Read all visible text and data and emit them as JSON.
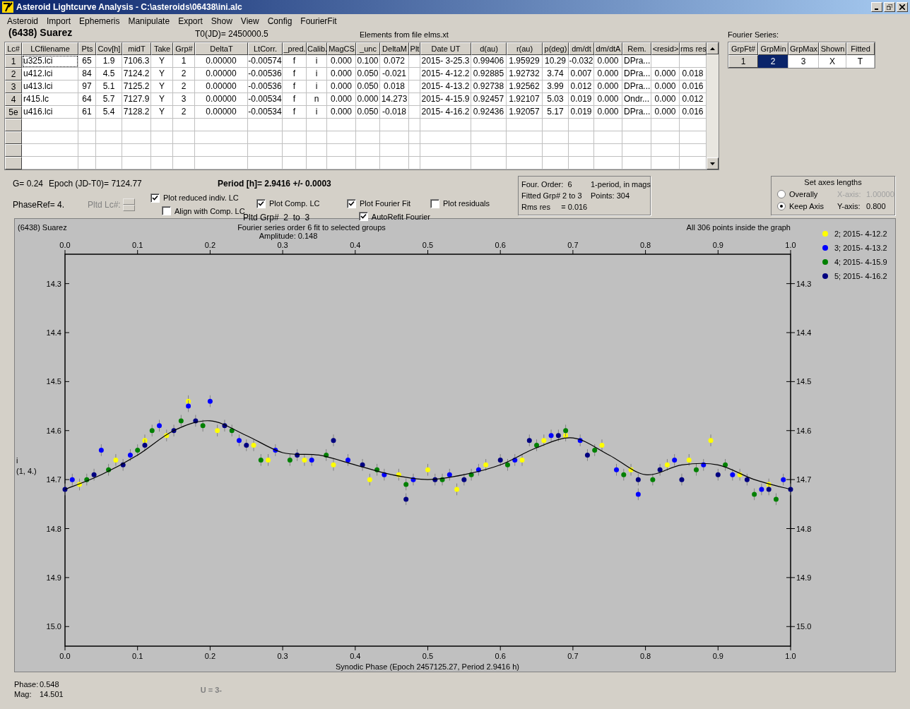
{
  "window": {
    "title": "Asteroid Lightcurve Analysis - C:\\asteroids\\06438\\ini.alc"
  },
  "menu": [
    "Asteroid",
    "Import",
    "Ephemeris",
    "Manipulate",
    "Export",
    "Show",
    "View",
    "Config",
    "FourierFit"
  ],
  "header": {
    "object": "(6438) Suarez",
    "t0": "T0(JD)= 2450000.5",
    "elements": "Elements from file elms.xt"
  },
  "table": {
    "columns": [
      "Lc#",
      "LCfilename",
      "Pts",
      "Cov[h]",
      "midT",
      "Take",
      "Grp#",
      "DeltaT",
      "LtCorr.",
      "_pred.",
      "Calib.",
      "MagCS",
      "_unc",
      "DeltaM",
      "Plt",
      "Date UT",
      "d(au)",
      "r(au)",
      "p(deg)",
      "dm/dt",
      "dm/dtA",
      "Rem.",
      "<resid>",
      "rms res"
    ],
    "rows": [
      {
        "focused": true,
        "cells": [
          "1",
          "u325.lci",
          "65",
          "1.9",
          "7106.3",
          "Y",
          "1",
          "0.00000",
          "-0.00574",
          "f",
          "i",
          "0.000",
          "0.100",
          "0.072",
          null,
          "2015- 3-25.3",
          "0.99406",
          "1.95929",
          "10.29",
          "-0.032",
          "0.000",
          "DPra...",
          null,
          null
        ]
      },
      {
        "focused": false,
        "cells": [
          "2",
          "u412.lci",
          "84",
          "4.5",
          "7124.2",
          "Y",
          "2",
          "0.00000",
          "-0.00536",
          "f",
          "i",
          "0.000",
          "0.050",
          "-0.021",
          null,
          "2015- 4-12.2",
          "0.92885",
          "1.92732",
          "3.74",
          "0.007",
          "0.000",
          "DPra...",
          "0.000",
          "0.018"
        ]
      },
      {
        "focused": false,
        "cells": [
          "3",
          "u413.lci",
          "97",
          "5.1",
          "7125.2",
          "Y",
          "2",
          "0.00000",
          "-0.00536",
          "f",
          "i",
          "0.000",
          "0.050",
          "0.018",
          null,
          "2015- 4-13.2",
          "0.92738",
          "1.92562",
          "3.99",
          "0.012",
          "0.000",
          "DPra...",
          "0.000",
          "0.016"
        ]
      },
      {
        "focused": false,
        "cells": [
          "4",
          "r415.lc",
          "64",
          "5.7",
          "7127.9",
          "Y",
          "3",
          "0.00000",
          "-0.00534",
          "f",
          "n",
          "0.000",
          "0.000",
          "14.273",
          null,
          "2015- 4-15.9",
          "0.92457",
          "1.92107",
          "5.03",
          "0.019",
          "0.000",
          "Ondr...",
          "0.000",
          "0.012"
        ]
      },
      {
        "focused": false,
        "cells": [
          "5e",
          "u416.lci",
          "61",
          "5.4",
          "7128.2",
          "Y",
          "2",
          "0.00000",
          "-0.00534",
          "f",
          "i",
          "0.000",
          "0.050",
          "-0.018",
          null,
          "2015- 4-16.2",
          "0.92436",
          "1.92057",
          "5.17",
          "0.019",
          "0.000",
          "DPra...",
          "0.000",
          "0.016"
        ]
      }
    ]
  },
  "fourier_series": {
    "label": "Fourier Series:",
    "columns": [
      "GrpFt#",
      "GrpMin",
      "GrpMax",
      "Shown",
      "Fitted"
    ],
    "row": {
      "header": "1",
      "cells": [
        {
          "text": "2",
          "selected": true
        },
        {
          "text": "3",
          "selected": false
        },
        {
          "text": "X",
          "selected": false
        },
        {
          "text": "T",
          "selected": false
        }
      ]
    }
  },
  "params": {
    "g": "G= 0.24",
    "epoch": "Epoch (JD-T0)= 7124.77",
    "phaseref": "PhaseRef= 4.",
    "period": "Period [h]= 2.9416 +/- 0.0003",
    "pltd_lc": {
      "label": "Pltd Lc#:",
      "disabled": true
    },
    "pltd_grp": "Pltd Grp#  2  to  3"
  },
  "options": [
    {
      "label": "Plot reduced indiv. LC",
      "checked": true
    },
    {
      "label": "Align with Comp. LC",
      "checked": false
    },
    {
      "label": "Plot Comp. LC",
      "checked": true
    },
    {
      "label": "Plot Fourier Fit",
      "checked": true
    },
    {
      "label": "Plot residuals",
      "checked": false
    },
    {
      "label": "AutoRefit Fourier",
      "checked": true
    }
  ],
  "fit_info": [
    "Four. Order:  6",
    "1-period, in mags",
    "Fitted Grp# 2 to 3",
    "Points: 304",
    "Rms res     = 0.016"
  ],
  "axes_lengths": {
    "title": "Set axes lengths",
    "modes": [
      {
        "label": "Overally",
        "selected": false
      },
      {
        "label": "Keep Axis",
        "selected": true
      }
    ],
    "fields": [
      {
        "label": "X-axis:",
        "value": "1.00000",
        "disabled": true
      },
      {
        "label": "Y-axis:",
        "value": "0.800",
        "disabled": false
      }
    ]
  },
  "plot": {
    "object": "(6438) Suarez",
    "amplitude": "Amplitude: 0.148",
    "points_note": "All 306 points inside the graph",
    "ylabel_extra": "(1, 4.)",
    "chart_data": {
      "type": "scatter",
      "title": "Fourier series order 6 fit to selected groups",
      "legend": "right",
      "xlabel": "Synodic Phase (Epoch 2457125.27, Period 2.9416 h)",
      "ylabel": "i",
      "xlim": [
        0,
        1
      ],
      "ylim": [
        15.04,
        14.24
      ],
      "xticks": [
        {
          "value": 0,
          "label": "0.0"
        },
        {
          "value": 0.1,
          "label": "0.1"
        },
        {
          "value": 0.2,
          "label": "0.2"
        },
        {
          "value": 0.3,
          "label": "0.3"
        },
        {
          "value": 0.4,
          "label": "0.4"
        },
        {
          "value": 0.5,
          "label": "0.5"
        },
        {
          "value": 0.6,
          "label": "0.6"
        },
        {
          "value": 0.7,
          "label": "0.7"
        },
        {
          "value": 0.8,
          "label": "0.8"
        },
        {
          "value": 0.9,
          "label": "0.9"
        },
        {
          "value": 1,
          "label": "1.0"
        }
      ],
      "yticks": [
        {
          "value": 14.3,
          "label": "14.3"
        },
        {
          "value": 14.4,
          "label": "14.4"
        },
        {
          "value": 14.5,
          "label": "14.5"
        },
        {
          "value": 14.6,
          "label": "14.6"
        },
        {
          "value": 14.7,
          "label": "14.7"
        },
        {
          "value": 14.8,
          "label": "14.8"
        },
        {
          "value": 14.9,
          "label": "14.9"
        },
        {
          "value": 15,
          "label": "15.0"
        }
      ],
      "series": [
        {
          "name": "2; 2015- 4-12.2",
          "color": "#ffff00",
          "x": [
            0.02,
            0.07,
            0.11,
            0.14,
            0.17,
            0.21,
            0.26,
            0.28,
            0.33,
            0.37,
            0.42,
            0.46,
            0.5,
            0.54,
            0.58,
            0.63,
            0.66,
            0.69,
            0.74,
            0.78,
            0.83,
            0.86,
            0.89,
            0.93,
            0.97
          ],
          "values": [
            14.71,
            14.66,
            14.62,
            14.61,
            14.54,
            14.6,
            14.63,
            14.66,
            14.66,
            14.67,
            14.7,
            14.69,
            14.68,
            14.72,
            14.67,
            14.66,
            14.62,
            14.61,
            14.63,
            14.68,
            14.67,
            14.66,
            14.62,
            14.69,
            14.71
          ]
        },
        {
          "name": "3; 2015- 4-13.2",
          "color": "#0000ff",
          "x": [
            0.01,
            0.05,
            0.09,
            0.13,
            0.17,
            0.2,
            0.24,
            0.29,
            0.34,
            0.39,
            0.44,
            0.48,
            0.53,
            0.57,
            0.62,
            0.67,
            0.71,
            0.76,
            0.79,
            0.84,
            0.88,
            0.92,
            0.96,
            0.99
          ],
          "values": [
            14.7,
            14.64,
            14.65,
            14.59,
            14.55,
            14.54,
            14.62,
            14.64,
            14.66,
            14.66,
            14.69,
            14.7,
            14.69,
            14.68,
            14.66,
            14.61,
            14.62,
            14.68,
            14.73,
            14.66,
            14.67,
            14.69,
            14.72,
            14.7
          ]
        },
        {
          "name": "4; 2015- 4-15.9",
          "color": "#008000",
          "x": [
            0.03,
            0.06,
            0.1,
            0.12,
            0.16,
            0.19,
            0.23,
            0.27,
            0.31,
            0.36,
            0.43,
            0.47,
            0.52,
            0.56,
            0.61,
            0.65,
            0.69,
            0.73,
            0.77,
            0.81,
            0.87,
            0.91,
            0.95,
            0.98
          ],
          "values": [
            14.7,
            14.68,
            14.64,
            14.6,
            14.58,
            14.59,
            14.6,
            14.66,
            14.66,
            14.65,
            14.68,
            14.71,
            14.7,
            14.69,
            14.67,
            14.63,
            14.6,
            14.64,
            14.69,
            14.7,
            14.68,
            14.67,
            14.73,
            14.74
          ]
        },
        {
          "name": "5; 2015- 4-16.2",
          "color": "#000080",
          "x": [
            0,
            0.04,
            0.08,
            0.11,
            0.15,
            0.18,
            0.22,
            0.25,
            0.32,
            0.37,
            0.41,
            0.47,
            0.51,
            0.55,
            0.6,
            0.64,
            0.68,
            0.72,
            0.79,
            0.82,
            0.85,
            0.9,
            0.94,
            0.97,
            1
          ],
          "values": [
            14.72,
            14.69,
            14.67,
            14.63,
            14.6,
            14.58,
            14.59,
            14.63,
            14.65,
            14.62,
            14.67,
            14.74,
            14.7,
            14.7,
            14.66,
            14.62,
            14.61,
            14.65,
            14.7,
            14.68,
            14.7,
            14.69,
            14.7,
            14.72,
            14.72
          ]
        },
        {
          "type": "line",
          "color": "#000000",
          "x": [
            0,
            0.05,
            0.1,
            0.15,
            0.2,
            0.25,
            0.3,
            0.35,
            0.4,
            0.45,
            0.5,
            0.55,
            0.6,
            0.65,
            0.7,
            0.75,
            0.8,
            0.85,
            0.9,
            0.95,
            1
          ],
          "values": [
            14.72,
            14.69,
            14.65,
            14.6,
            14.58,
            14.61,
            14.645,
            14.65,
            14.67,
            14.69,
            14.7,
            14.69,
            14.67,
            14.635,
            14.615,
            14.65,
            14.69,
            14.67,
            14.67,
            14.7,
            14.72
          ]
        }
      ]
    }
  },
  "status": {
    "phase_label": "Phase:",
    "phase": "0.548",
    "mag_label": "Mag:",
    "mag": "14.501",
    "u": "U = 3-"
  }
}
